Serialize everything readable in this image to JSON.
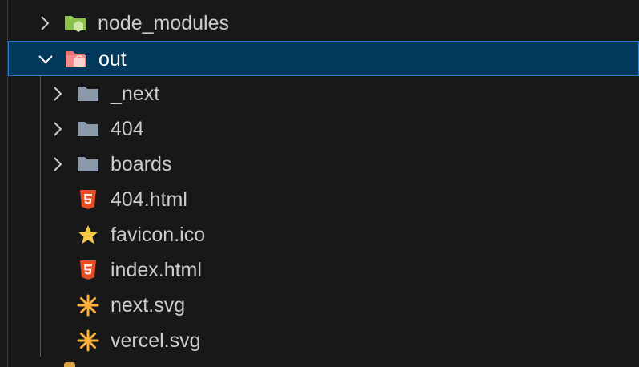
{
  "explorer": {
    "items": [
      {
        "label": "node_modules",
        "icon": "node-folder-icon",
        "expanded": false,
        "level": 0
      },
      {
        "label": "out",
        "icon": "open-folder-icon",
        "expanded": true,
        "level": 0,
        "selected": true
      },
      {
        "label": "_next",
        "icon": "folder-icon",
        "expanded": false,
        "level": 1
      },
      {
        "label": "404",
        "icon": "folder-icon",
        "expanded": false,
        "level": 1
      },
      {
        "label": "boards",
        "icon": "folder-icon",
        "expanded": false,
        "level": 1
      },
      {
        "label": "404.html",
        "icon": "html5-icon",
        "level": 1
      },
      {
        "label": "favicon.ico",
        "icon": "star-icon",
        "level": 1
      },
      {
        "label": "index.html",
        "icon": "html5-icon",
        "level": 1
      },
      {
        "label": "next.svg",
        "icon": "svg-asterisk-icon",
        "level": 1
      },
      {
        "label": "vercel.svg",
        "icon": "svg-asterisk-icon",
        "level": 1
      }
    ]
  },
  "colors": {
    "background": "#181818",
    "selection": "#04395e",
    "selection_border": "#2b79d0",
    "folder": "#8a9aaa",
    "node_folder": "#8bc34a",
    "html": "#e44d26",
    "star": "#f7c948",
    "svg": "#ffb13b"
  }
}
